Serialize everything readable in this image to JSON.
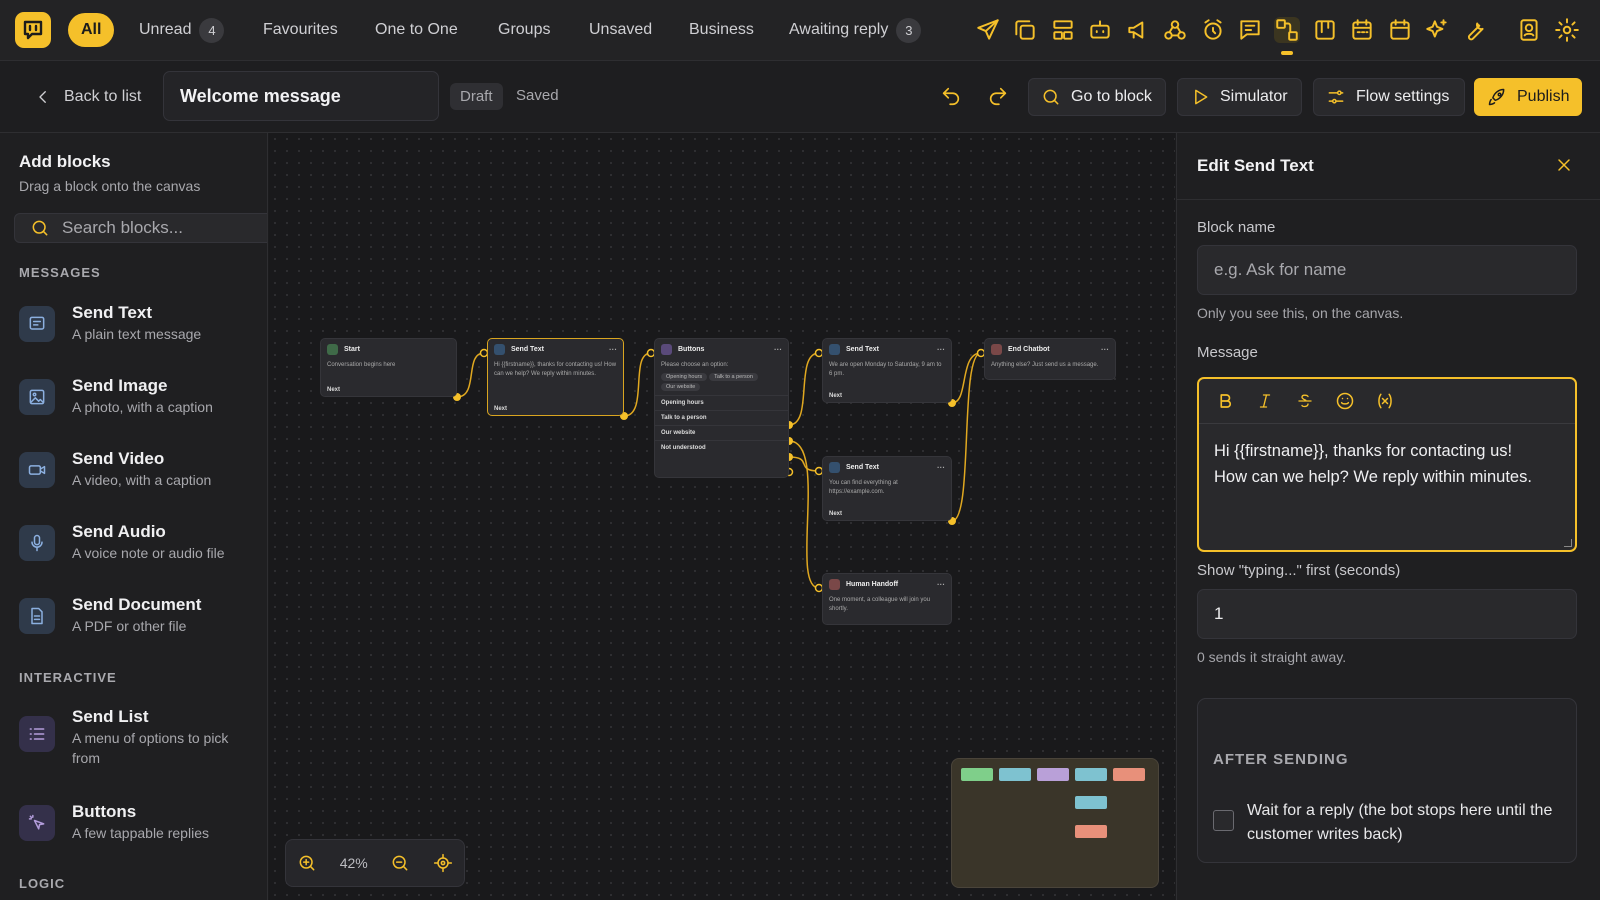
{
  "filters": [
    {
      "label": "All",
      "active": true
    },
    {
      "label": "Unread",
      "count": "4"
    },
    {
      "label": "Favourites"
    },
    {
      "label": "One to One"
    },
    {
      "label": "Groups"
    },
    {
      "label": "Unsaved"
    },
    {
      "label": "Business"
    },
    {
      "label": "Awaiting reply",
      "count": "3"
    }
  ],
  "toolbar": {
    "back_label": "Back to list",
    "flow_name": "Welcome message",
    "status_badge": "Draft",
    "save_state": "Saved",
    "goto_label": "Go to block",
    "simulator_label": "Simulator",
    "settings_label": "Flow settings",
    "publish_label": "Publish"
  },
  "sidebar": {
    "title": "Add blocks",
    "subtitle": "Drag a block onto the canvas",
    "search_placeholder": "Search blocks...",
    "sections": {
      "messages": "MESSAGES",
      "interactive": "INTERACTIVE",
      "logic": "LOGIC"
    },
    "blocks": [
      {
        "title": "Send Text",
        "desc": "A plain text message"
      },
      {
        "title": "Send Image",
        "desc": "A photo, with a caption"
      },
      {
        "title": "Send Video",
        "desc": "A video, with a caption"
      },
      {
        "title": "Send Audio",
        "desc": "A voice note or audio file"
      },
      {
        "title": "Send Document",
        "desc": "A PDF or other file"
      },
      {
        "title": "Send List",
        "desc": "A menu of options to pick from"
      },
      {
        "title": "Buttons",
        "desc": "A few tappable replies"
      }
    ]
  },
  "canvas": {
    "zoom": "42%",
    "nodes": {
      "start": {
        "title": "Start",
        "body": "Conversation begins here",
        "foot": "Next"
      },
      "send1": {
        "title": "Send Text",
        "body": "Hi {{firstname}}, thanks for contacting us! How can we help? We reply within minutes.",
        "foot": "Next"
      },
      "buttons": {
        "title": "Buttons",
        "body": "Please choose an option:",
        "chips": [
          "Opening hours",
          "Talk to a person",
          "Our website"
        ],
        "outputs": [
          "Opening hours",
          "Talk to a person",
          "Our website",
          "Not understood"
        ]
      },
      "send2": {
        "title": "Send Text",
        "body": "We are open Monday to Saturday, 9 am to 6 pm.",
        "foot": "Next"
      },
      "send3": {
        "title": "Send Text",
        "body": "You can find everything at https://example.com.",
        "foot": "Next"
      },
      "handoff": {
        "title": "Human Handoff",
        "body": "One moment, a colleague will join you shortly."
      },
      "end": {
        "title": "End Chatbot",
        "body": "Anything else? Just send us a message."
      }
    }
  },
  "editor": {
    "title": "Edit Send Text",
    "block_name_label": "Block name",
    "block_name_placeholder": "e.g. Ask for name",
    "block_name_hint": "Only you see this, on the canvas.",
    "message_label": "Message",
    "message_text": "Hi {{firstname}}, thanks for contacting us!\nHow can we help? We reply within minutes.",
    "typing_label": "Show \"typing...\" first (seconds)",
    "typing_value": "1",
    "typing_hint": "0 sends it straight away.",
    "after_heading": "AFTER SENDING",
    "wait_label": "Wait for a reply (the bot stops here until the customer writes back)",
    "wait_checked": false
  },
  "colors": {
    "accent": "#f5c02a",
    "minimap": [
      "#7fcf8a",
      "#7ec2d0",
      "#b9a0d8",
      "#7ec2d0",
      "#e8907a"
    ]
  }
}
